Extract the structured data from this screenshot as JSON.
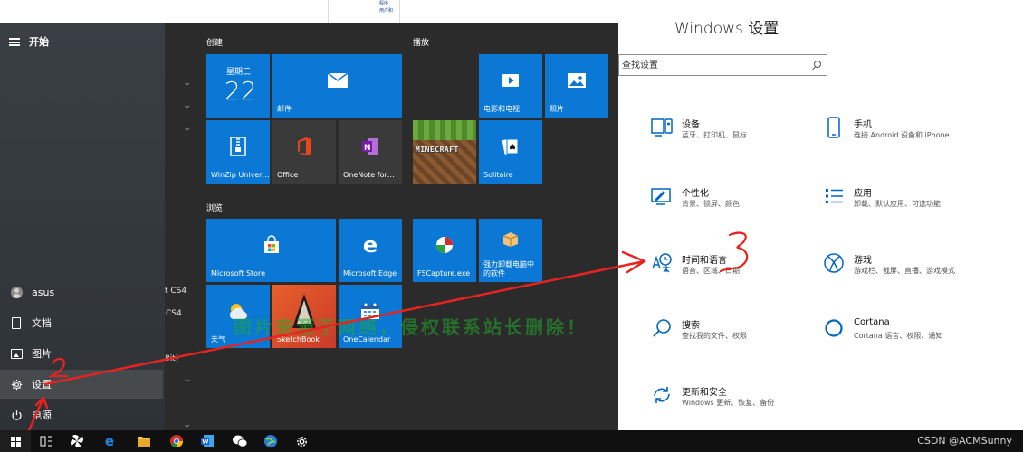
{
  "background_doc": {
    "lines": [
      "程序",
      "用户和"
    ]
  },
  "start_menu": {
    "header_label": "开始",
    "app_list_fragments": [
      "t CS4",
      "CS4",
      "8it)"
    ],
    "rail": {
      "user": "asus",
      "documents": "文档",
      "pictures": "图片",
      "settings": "设置",
      "power": "电源"
    },
    "groups": {
      "create": "创建",
      "play": "播放",
      "browse": "浏览"
    },
    "tiles": {
      "calendar_day": "星期三",
      "calendar_date": "22",
      "mail": "邮件",
      "movies_tv": "电影和电视",
      "photos": "照片",
      "winzip": "WinZip Univer…",
      "office": "Office",
      "onenote": "OneNote for…",
      "minecraft_art": "MINECRAFT",
      "solitaire": "Solitaire",
      "store": "Microsoft Store",
      "edge": "Microsoft Edge",
      "fscapture": "FSCapture.exe",
      "uninstaller": "强力卸载电脑中的软件",
      "weather": "天气",
      "sketchbook": "SketchBook",
      "onecalendar": "OneCalendar"
    }
  },
  "settings_window": {
    "title": "Windows 设置",
    "search_placeholder": "查找设置",
    "categories": [
      {
        "title": "设备",
        "subtitle": "蓝牙、打印机、鼠标",
        "icon": "devices-icon"
      },
      {
        "title": "手机",
        "subtitle": "连接 Android 设备和 iPhone",
        "icon": "phone-icon"
      },
      {
        "title": "个性化",
        "subtitle": "背景、锁屏、颜色",
        "icon": "personalization-icon"
      },
      {
        "title": "应用",
        "subtitle": "卸载、默认应用、可选功能",
        "icon": "apps-icon"
      },
      {
        "title": "时间和语言",
        "subtitle": "语音、区域、日期",
        "icon": "time-language-icon"
      },
      {
        "title": "游戏",
        "subtitle": "游戏栏、截屏、直播、游戏模式",
        "icon": "gaming-icon"
      },
      {
        "title": "搜索",
        "subtitle": "查找我的文件、权限",
        "icon": "search-icon"
      },
      {
        "title": "Cortana",
        "subtitle": "Cortana 语言、权限、通知",
        "icon": "cortana-icon"
      },
      {
        "title": "更新和安全",
        "subtitle": "Windows 更新、恢复、备份",
        "icon": "update-security-icon"
      }
    ]
  },
  "annotations": {
    "mark_2": "2",
    "mark_3": "3"
  },
  "watermark": "图片来源于网络，侵权联系站长删除！",
  "taskbar": {
    "watermark_user": "CSDN @ACMSunny"
  },
  "colors": {
    "tile_blue": "#0a78d4",
    "settings_icon_blue": "#0067c0",
    "annotation_red": "#e8231f"
  }
}
